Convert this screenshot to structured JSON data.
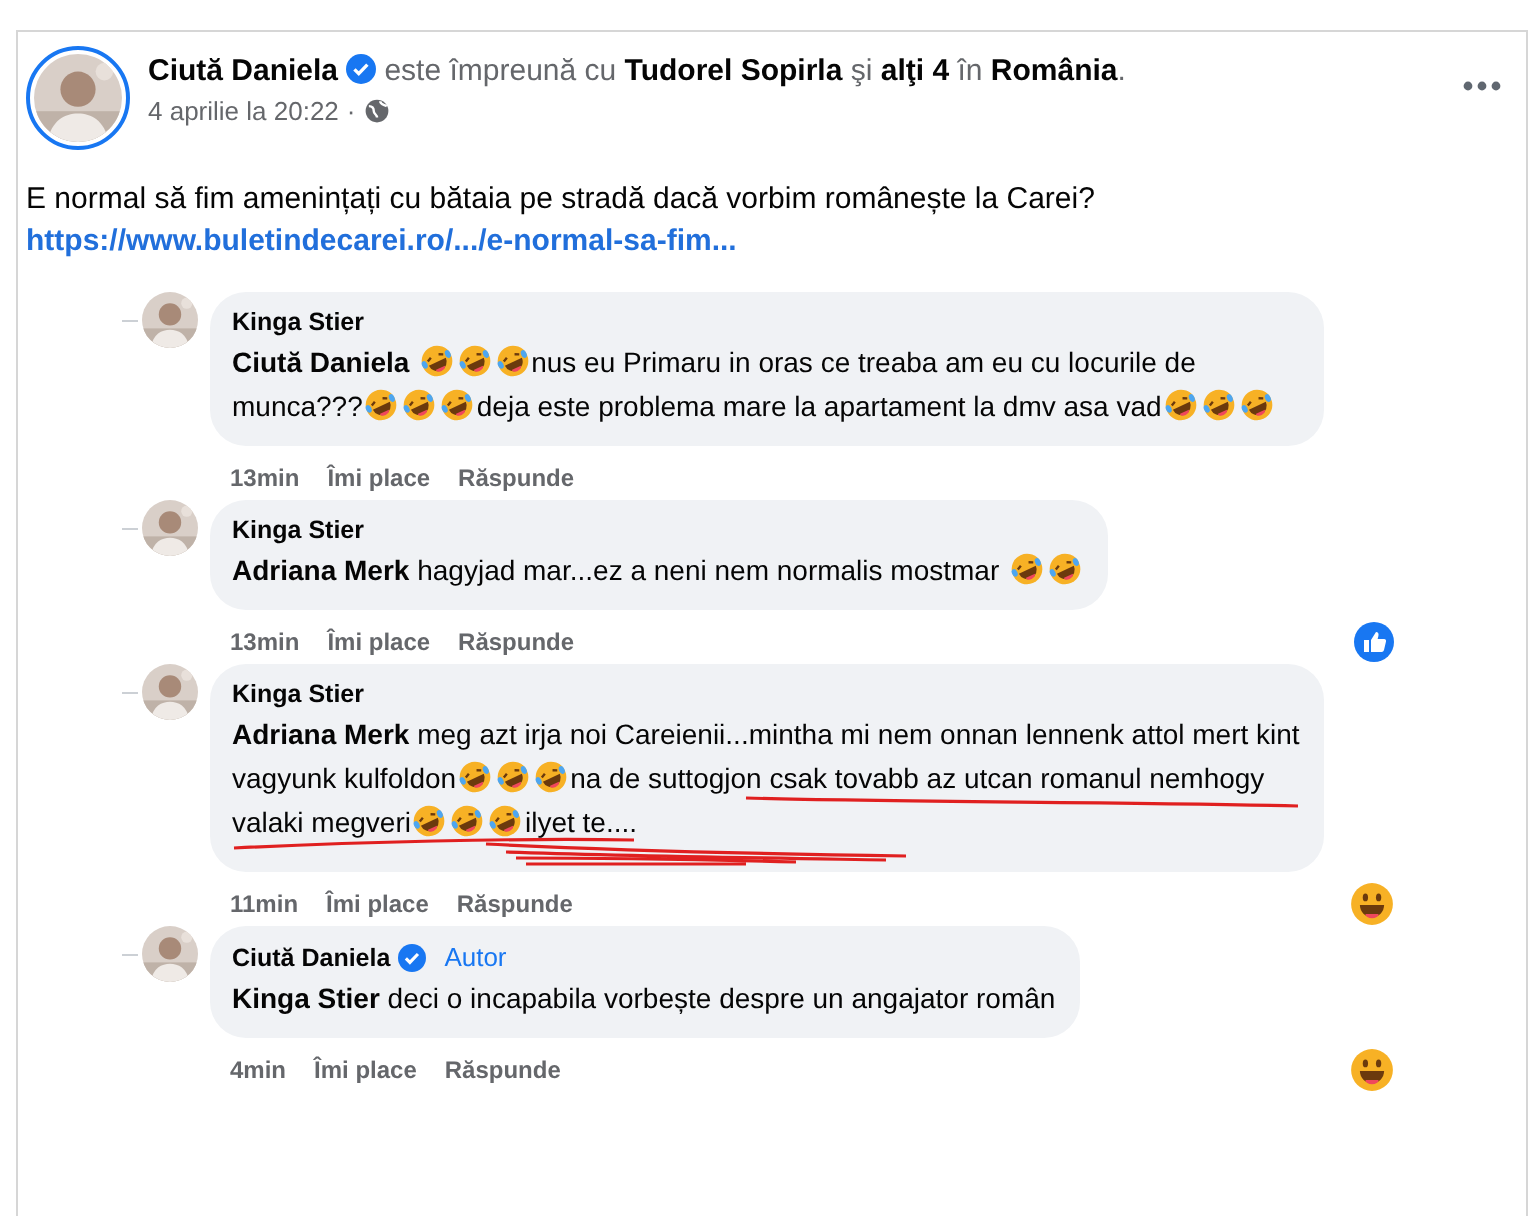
{
  "post": {
    "author": "Ciută Daniela",
    "verified": true,
    "with_text": "este împreună cu",
    "with_name": "Tudorel Sopirla",
    "and_text": "şi",
    "others": "alţi 4",
    "in_text": "în",
    "place": "România",
    "end": ".",
    "date": "4 aprilie la 20:22",
    "separator": "·",
    "text": "E normal să fim amenințați cu bătaia pe stradă dacă vorbim românește la Carei?",
    "link": "https://www.buletindecarei.ro/.../e-normal-sa-fim..."
  },
  "comments": [
    {
      "author": "Kinga Stier",
      "mention": "Ciută Daniela",
      "parts": [
        {
          "kind": "emoji"
        },
        {
          "kind": "emoji"
        },
        {
          "kind": "emoji"
        },
        {
          "kind": "text",
          "text": "nus eu Primaru in oras ce treaba am eu cu locurile de munca???"
        },
        {
          "kind": "emoji"
        },
        {
          "kind": "emoji"
        },
        {
          "kind": "emoji"
        },
        {
          "kind": "text",
          "text": "deja este problema mare la apartament la dmv asa vad"
        },
        {
          "kind": "emoji"
        },
        {
          "kind": "emoji"
        },
        {
          "kind": "emoji"
        }
      ],
      "time": "13min",
      "like": "Îmi place",
      "reply": "Răspunde"
    },
    {
      "author": "Kinga Stier",
      "mention": "Adriana Merk",
      "parts": [
        {
          "kind": "text",
          "text": "hagyjad mar...ez a neni nem normalis mostmar "
        },
        {
          "kind": "emoji"
        },
        {
          "kind": "emoji"
        }
      ],
      "time": "13min",
      "like": "Îmi place",
      "reply": "Răspunde",
      "reaction": {
        "kind": "like"
      }
    },
    {
      "author": "Kinga Stier",
      "mention": "Adriana Merk",
      "underlined": true,
      "parts": [
        {
          "kind": "text",
          "text": "meg azt irja noi Careienii...mintha mi nem onnan lennenk attol mert kint vagyunk kulfoldon"
        },
        {
          "kind": "emoji"
        },
        {
          "kind": "emoji"
        },
        {
          "kind": "emoji"
        },
        {
          "kind": "text",
          "text": "na de suttogjon csak tovabb az utcan romanul nemhogy valaki megveri"
        },
        {
          "kind": "emoji"
        },
        {
          "kind": "emoji"
        },
        {
          "kind": "emoji"
        },
        {
          "kind": "text",
          "text": "ilyet te...."
        }
      ],
      "time": "11min",
      "like": "Îmi place",
      "reply": "Răspunde",
      "reaction": {
        "kind": "haha"
      }
    },
    {
      "author": "Ciută Daniela",
      "verified": true,
      "badge": "Autor",
      "mention": "Kinga Stier",
      "parts": [
        {
          "kind": "text",
          "text": "deci o incapabila vorbește despre un angajator român"
        }
      ],
      "time": "4min",
      "like": "Îmi place",
      "reply": "Răspunde",
      "reaction": {
        "kind": "haha"
      }
    }
  ]
}
